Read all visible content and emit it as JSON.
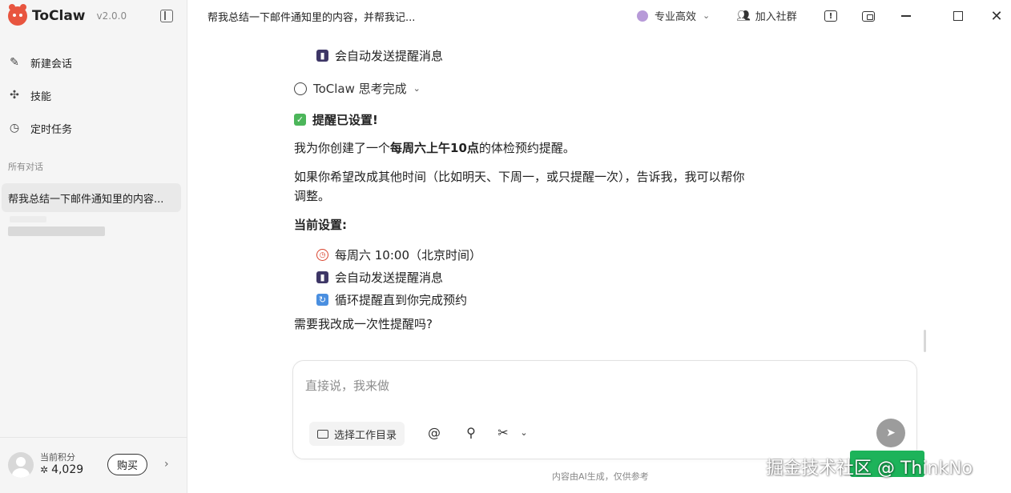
{
  "app": {
    "name": "ToClaw",
    "version": "v2.0.0",
    "brand_color": "#e8553f"
  },
  "sidebar": {
    "nav": [
      {
        "label": "新建会话",
        "icon": "edit-icon"
      },
      {
        "label": "技能",
        "icon": "puzzle-icon"
      },
      {
        "label": "定时任务",
        "icon": "clock-icon"
      }
    ],
    "section_label": "所有对话",
    "conversations": [
      {
        "title": "帮我总结一下邮件通知里的内容...",
        "active": true
      }
    ],
    "footer": {
      "points_label": "当前积分",
      "points_value": "4,029",
      "buy_label": "购买"
    }
  },
  "topbar": {
    "title": "帮我总结一下邮件通知里的内容，并帮我记...",
    "mode": "专业高效",
    "community": "加入社群",
    "icons": [
      "feedback-icon",
      "pip-icon",
      "minimize-icon",
      "maximize-icon",
      "close-icon"
    ]
  },
  "chat": {
    "prev_bullet": "会自动发送提醒消息",
    "thinking_label": "ToClaw 思考完成",
    "heading": "提醒已设置!",
    "line1_prefix": "我为你创建了一个",
    "line1_bold": "每周六上午10点",
    "line1_suffix": "的体检预约提醒。",
    "line2a": "如果你希望改成其他时间（比如明天、下周一，或只提醒一次），告诉我，我可以帮你",
    "line2b": "调整。",
    "settings_heading": "当前设置:",
    "settings": [
      {
        "icon": "alarm-clock-icon",
        "text": "每周六 10:00（北京时间）"
      },
      {
        "icon": "mobile-phone-icon",
        "text": "会自动发送提醒消息"
      },
      {
        "icon": "repeat-icon",
        "text": "循环提醒直到你完成预约"
      }
    ],
    "question": "需要我改成一次性提醒吗?"
  },
  "composer": {
    "placeholder": "直接说，我来做",
    "dir_label": "选择工作目录"
  },
  "disclaimer": "内容由AI生成，仅供参考",
  "watermark": "掘金技术社区 @ ThinkNo"
}
